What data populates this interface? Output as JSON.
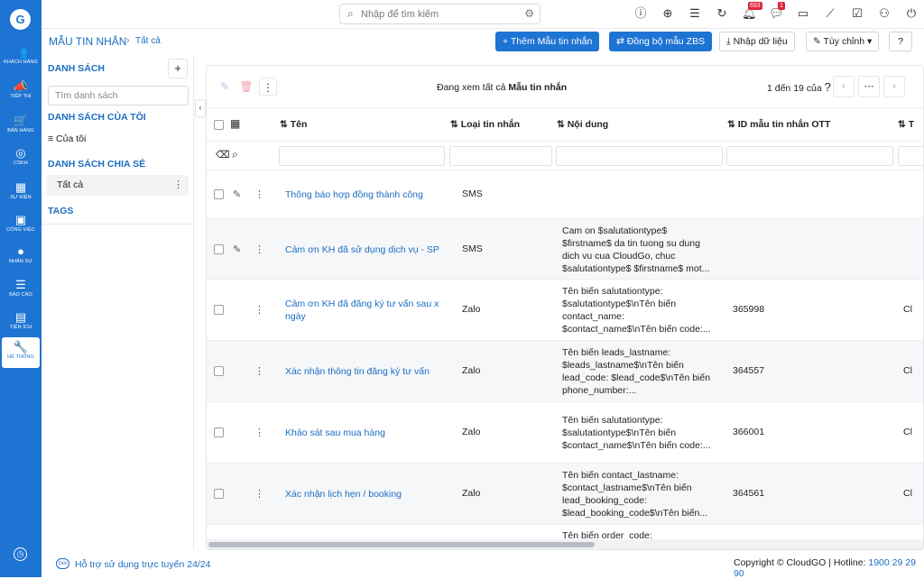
{
  "sidebar": {
    "logo": "G",
    "items": [
      {
        "label": "KHÁCH HÀNG",
        "icon": "users-icon",
        "glyph": "👥"
      },
      {
        "label": "TIẾP THỊ",
        "icon": "megaphone-icon",
        "glyph": "📣"
      },
      {
        "label": "BÁN HÀNG",
        "icon": "cart-icon",
        "glyph": "🛒"
      },
      {
        "label": "CSKH",
        "icon": "support-icon",
        "glyph": "◎"
      },
      {
        "label": "SỰ KIỆN",
        "icon": "calendar-icon",
        "glyph": "▦"
      },
      {
        "label": "CÔNG VIỆC",
        "icon": "briefcase-icon",
        "glyph": "▣"
      },
      {
        "label": "NHÂN SỰ",
        "icon": "person-icon",
        "glyph": "●"
      },
      {
        "label": "BÁO CÁO",
        "icon": "report-icon",
        "glyph": "☰"
      },
      {
        "label": "TIỆN ÍCH",
        "icon": "gift-icon",
        "glyph": "▤"
      },
      {
        "label": "HỆ THỐNG",
        "icon": "wrench-icon",
        "glyph": "🔧"
      }
    ],
    "bottom_icon": "clock-icon"
  },
  "topbar": {
    "search_placeholder": "Nhập để tìm kiếm",
    "notifications_count": "693",
    "messages_count": "1"
  },
  "header": {
    "title": "Mẫu tin nhắn",
    "breadcrumb_sep": "›",
    "breadcrumb": "Tất cả",
    "buttons": {
      "add": "Thêm Mẫu tin nhắn",
      "sync": "Đồng bộ mẫu ZBS",
      "import": "Nhập dữ liệu",
      "customize": "Tùy chỉnh"
    }
  },
  "left_panel": {
    "list_title": "DANH SÁCH",
    "search_placeholder": "Tìm danh sách",
    "my_lists_title": "DANH SÁCH CỦA TÔI",
    "my_item": "Của tôi",
    "shared_title": "DANH SÁCH CHIA SẺ",
    "shared_item": "Tất cả",
    "tags_title": "TAGS"
  },
  "table": {
    "viewing_prefix": "Đang xem tất cả",
    "viewing_module": "Mẫu tin nhắn",
    "page_info": "1 đến 19 của",
    "page_help": "?",
    "columns": {
      "name": "Tên",
      "type": "Loại tin nhắn",
      "content": "Nội dung",
      "ott_id": "ID mẫu tin nhắn OTT",
      "next": "T"
    },
    "rows": [
      {
        "name": "Thông báo hợp đồng thành công",
        "type": "SMS",
        "content": "",
        "id": "",
        "extra": ""
      },
      {
        "name": "Cảm ơn KH đã sử dụng dịch vụ - SP",
        "type": "SMS",
        "content": "Cam on $salutationtype$\n$firstname$ da tin tuong su dung\ndich vu cua CloudGo, chuc\n$salutationtype$ $firstname$ mot...",
        "id": "",
        "extra": ""
      },
      {
        "name": "Cảm ơn KH đã đăng ký tư vấn sau x ngày",
        "type": "Zalo",
        "content": "Tên biến salutationtype:\n$salutationtype$\\nTên biến\ncontact_name:\n$contact_name$\\nTên biến code:...",
        "id": "365998",
        "extra": "Cl"
      },
      {
        "name": "Xác nhận thông tin đăng ký tư vấn",
        "type": "Zalo",
        "content": "Tên biến leads_lastname:\n$leads_lastname$\\nTên biến\nlead_code: $lead_code$\\nTên biến\nphone_number:...",
        "id": "364557",
        "extra": "Cl"
      },
      {
        "name": "Khảo sát sau mua hàng",
        "type": "Zalo",
        "content": "Tên biến salutationtype:\n$salutationtype$\\nTên biến\n$contact_name$\\nTên biến code:...",
        "id": "366001",
        "extra": "Cl"
      },
      {
        "name": "Xác nhận lịch hẹn / booking",
        "type": "Zalo",
        "content": "Tên biến contact_lastname:\n$contact_lastname$\\nTên biến\nlead_booking_code:\n$lead_booking_code$\\nTên biến...",
        "id": "364561",
        "extra": "Cl"
      },
      {
        "name": "",
        "type": "",
        "content": "Tên biến order_code:",
        "id": "",
        "extra": ""
      }
    ]
  },
  "footer": {
    "logo": "Zalo",
    "support": "Hỗ trợ sử dụng trực tuyến 24/24",
    "copyright": "Copyright © CloudGO",
    "hotline_label": "| Hotline:",
    "hotline": "1900 29 29 90"
  }
}
